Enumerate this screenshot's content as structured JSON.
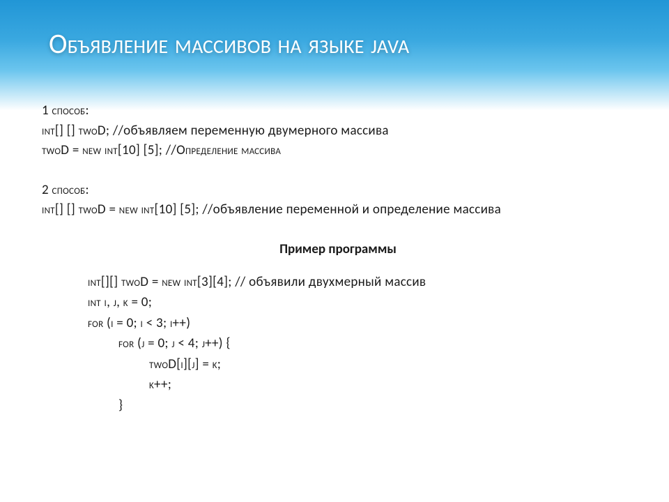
{
  "title": "Объявление массивов на языке Java",
  "method1": {
    "heading": "1 способ:",
    "line1a": " int[] [] twoD;  ",
    "line1b": "//объявляем переменную двумерного массива",
    "line2a": "twoD = new int[10] [5];   ",
    "line2b": "//Определение массива"
  },
  "method2": {
    "heading": "2 способ:",
    "line1a": "int[] [] twoD = new int[10] [5]; ",
    "line1b": "//объявление переменной и определение массива"
  },
  "example": {
    "title": "Пример программы",
    "l1a": "int[][] twoD = new int[3][4]; ",
    "l1b": "// объявили двухмерный массив",
    "l2": "int i, j, k = 0;",
    "blank": " ",
    "l3": "for (i = 0; i < 3; i++)",
    "l4": "for (j = 0; j < 4; j++) {",
    "l5": "twoD[i][j] = k;",
    "l6": "k++;",
    "l7": "}"
  }
}
